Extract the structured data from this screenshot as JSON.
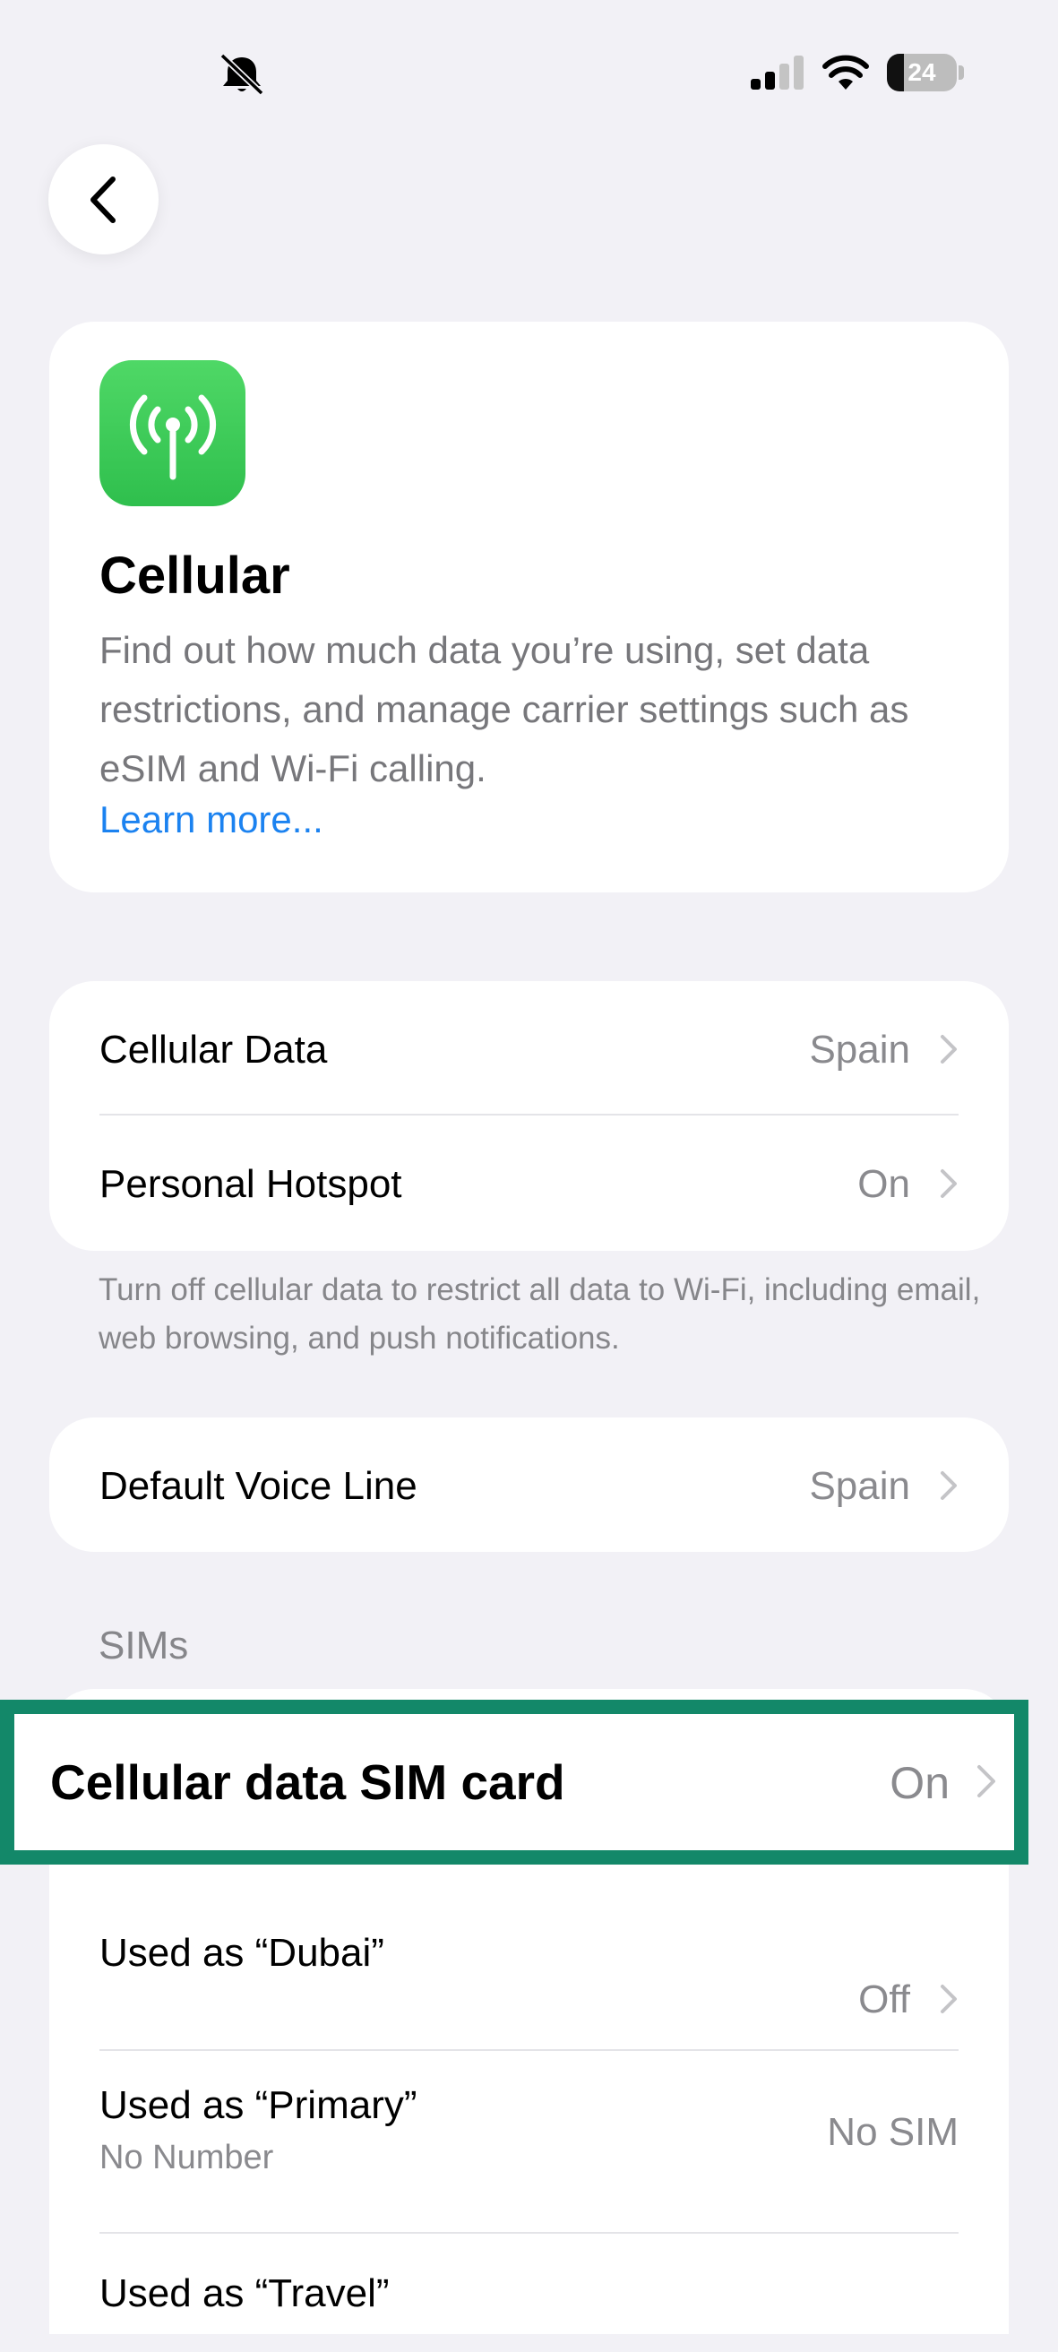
{
  "status_bar": {
    "icons": [
      "bell-slash-icon",
      "cellular-signal-icon",
      "wifi-icon",
      "battery-icon"
    ],
    "battery_level": "24"
  },
  "nav": {
    "back_icon": "chevron-left-icon"
  },
  "header": {
    "icon": "antenna-icon",
    "title": "Cellular",
    "description": "Find out how much data you’re using, set data restrictions, and manage carrier settings such as eSIM and Wi-Fi calling.",
    "learn_more": "Learn more..."
  },
  "data_section": {
    "rows": [
      {
        "label": "Cellular Data",
        "value": "Spain"
      },
      {
        "label": "Personal Hotspot",
        "value": "On"
      }
    ],
    "footer": "Turn off cellular data to restrict all data to Wi-Fi, including email, web browsing, and push notifications."
  },
  "voice_section": {
    "label": "Default Voice Line",
    "value": "Spain"
  },
  "sims_section": {
    "header": "SIMs",
    "highlighted_row": {
      "label": "Cellular data SIM card",
      "value": "On"
    },
    "rows": [
      {
        "label": "Used as “Dubai”",
        "value": "Off"
      },
      {
        "label": "Used as “Primary”",
        "subtitle": "No Number",
        "value": "No SIM"
      },
      {
        "label": "Used as “Travel”"
      }
    ]
  },
  "colors": {
    "background": "#f2f1f6",
    "accent_link": "#1b82f0",
    "app_icon_green": "#34c759",
    "highlight_border": "#138869"
  }
}
